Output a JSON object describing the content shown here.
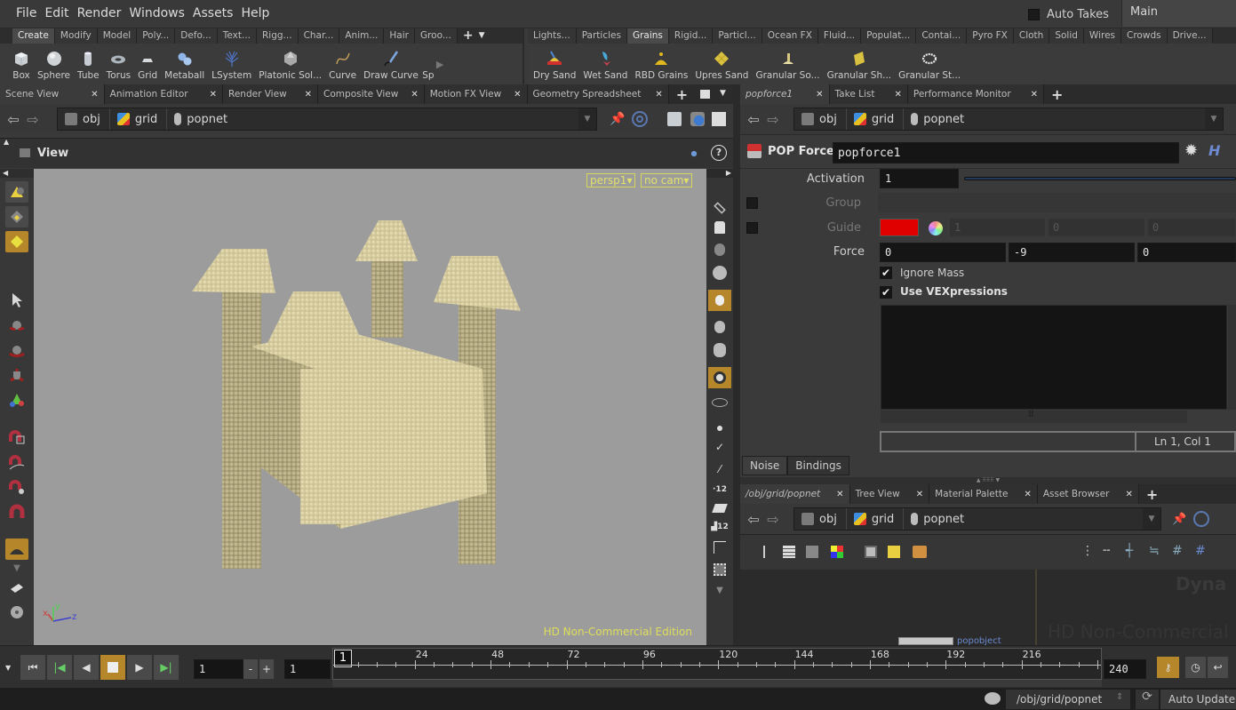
{
  "menubar": {
    "items": [
      "File",
      "Edit",
      "Render",
      "Windows",
      "Assets",
      "Help"
    ],
    "auto_takes_label": "Auto Takes",
    "auto_takes_checked": false,
    "take_selector": "Main"
  },
  "shelf_left": {
    "tabs": [
      "Create",
      "Modify",
      "Model",
      "Poly...",
      "Defo...",
      "Text...",
      "Rigg...",
      "Char...",
      "Anim...",
      "Hair",
      "Groo..."
    ],
    "active_tab": "Create",
    "tools": [
      "Box",
      "Sphere",
      "Tube",
      "Torus",
      "Grid",
      "Metaball",
      "LSystem",
      "Platonic Sol...",
      "Curve",
      "Draw Curve",
      "Sp"
    ]
  },
  "shelf_right": {
    "tabs": [
      "Lights...",
      "Particles",
      "Grains",
      "Rigid...",
      "Particl...",
      "Ocean FX",
      "Fluid...",
      "Populat...",
      "Contai...",
      "Pyro FX",
      "Cloth",
      "Solid",
      "Wires",
      "Crowds",
      "Drive..."
    ],
    "active_tab": "Grains",
    "tools": [
      "Dry Sand",
      "Wet Sand",
      "RBD Grains",
      "Upres Sand",
      "Granular So...",
      "Granular Sh...",
      "Granular St..."
    ]
  },
  "left_pane": {
    "tabs": [
      "Scene View",
      "Animation Editor",
      "Render View",
      "Composite View",
      "Motion FX View",
      "Geometry Spreadsheet"
    ],
    "active_tab": "Scene View",
    "path": [
      "obj",
      "grid",
      "popnet"
    ],
    "view_title": "View",
    "camera_menu": "persp1",
    "cam_menu": "no cam",
    "watermark": "HD Non-Commercial Edition",
    "axis_labels": [
      "x",
      "y",
      "z"
    ]
  },
  "param_pane": {
    "tabs": [
      "popforce1",
      "Take List",
      "Performance Monitor"
    ],
    "active_tab": "popforce1",
    "path": [
      "obj",
      "grid",
      "popnet"
    ],
    "node_type": "POP Force",
    "node_name": "popforce1",
    "params": {
      "activation_label": "Activation",
      "activation_value": "1",
      "group_label": "Group",
      "guide_label": "Guide",
      "guide_color": "#e00000",
      "guide_values": [
        "1",
        "0",
        "0"
      ],
      "force_label": "Force",
      "force_values": [
        "0",
        "-9",
        "0"
      ],
      "ignore_mass_label": "Ignore Mass",
      "ignore_mass_checked": true,
      "use_vex_label": "Use VEXpressions",
      "use_vex_checked": true,
      "editor_status": "Ln 1, Col 1"
    },
    "subtabs": [
      "Noise",
      "Bindings"
    ]
  },
  "network_pane": {
    "tabs": [
      "/obj/grid/popnet",
      "Tree View",
      "Material Palette",
      "Asset Browser"
    ],
    "active_tab": "/obj/grid/popnet",
    "path": [
      "obj",
      "grid",
      "popnet"
    ],
    "node_label": "popobject",
    "watermark_top": "Dyna",
    "watermark": "HD Non-Commercial Ed"
  },
  "timeline": {
    "current_frame": "1",
    "step_value": "1",
    "start_frame": "1",
    "end_frame": "240",
    "ruler_marker": "1",
    "ticks": [
      "24",
      "48",
      "72",
      "96",
      "120",
      "144",
      "168",
      "192",
      "216"
    ]
  },
  "statusbar": {
    "path": "/obj/grid/popnet",
    "update_mode": "Auto Update"
  },
  "colors": {
    "accent": "#b5862a",
    "viewport_bg": "#9c9c9c",
    "sand": "#d2c79a",
    "hud_yellow": "#e1e16a"
  }
}
